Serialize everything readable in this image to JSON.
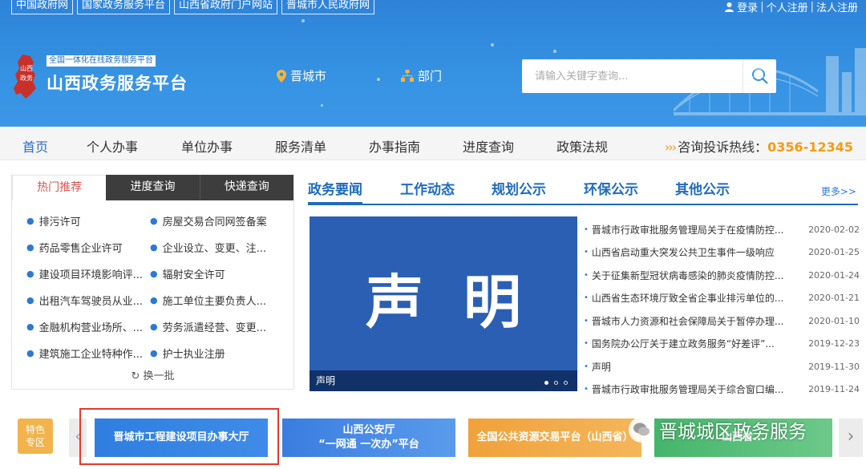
{
  "toplinks": [
    "中国政府网",
    "国家政务服务平台",
    "山西省政府门户网站",
    "晋城市人民政府网"
  ],
  "account": {
    "login": "登录",
    "personal_register": "个人注册",
    "corp_register": "法人注册"
  },
  "logo": {
    "emblem_text": "山西政务",
    "tag": "全国一体化在线政务服务平台",
    "title": "山西政务服务平台"
  },
  "location": "晋城市",
  "department": "部门",
  "search": {
    "placeholder": "请输入关键字查询..."
  },
  "nav": {
    "items": [
      "首页",
      "个人办事",
      "单位办事",
      "服务清单",
      "办事指南",
      "进度查询",
      "政策法规"
    ],
    "active_index": 0,
    "hotline_label": "咨询投诉热线：",
    "hotline_number": "0356-12345"
  },
  "left_panel": {
    "tabs": [
      "热门推荐",
      "进度查询",
      "快递查询"
    ],
    "items": [
      "排污许可",
      "房屋交易合同网签备案",
      "药品零售企业许可",
      "企业设立、变更、注...",
      "建设项目环境影响评...",
      "辐射安全许可",
      "出租汽车驾驶员从业...",
      "施工单位主要负责人...",
      "金融机构营业场所、...",
      "劳务派遣经营、变更...",
      "建筑施工企业特种作...",
      "护士执业注册"
    ],
    "refresh": "换一批"
  },
  "news": {
    "tabs": [
      "政务要闻",
      "工作动态",
      "规划公示",
      "环保公示",
      "其他公示"
    ],
    "more": "更多>>",
    "slide": {
      "big_text": "声明",
      "caption": "声明",
      "dots": 3,
      "active_dot": 0
    },
    "items": [
      {
        "title": "晋城市行政审批服务管理局关于在疫情防控...",
        "date": "2020-02-02"
      },
      {
        "title": "山西省启动重大突发公共卫生事件一级响应",
        "date": "2020-01-25"
      },
      {
        "title": "关于征集新型冠状病毒感染的肺炎疫情防控...",
        "date": "2020-01-24"
      },
      {
        "title": "山西省生态环境厅致全省企事业排污单位的...",
        "date": "2020-01-21"
      },
      {
        "title": "晋城市人力资源和社会保障局关于暂停办理...",
        "date": "2020-01-10"
      },
      {
        "title": "国务院办公厅关于建立政务服务“好差评”...",
        "date": "2019-12-23"
      },
      {
        "title": "声明",
        "date": "2019-11-30"
      },
      {
        "title": "晋城市行政审批服务管理局关于综合窗口编...",
        "date": "2019-11-24"
      }
    ]
  },
  "feature": {
    "line1": "特色",
    "line2": "专区"
  },
  "banners": [
    {
      "line1": "晋城市工程建设项目办事大厅",
      "line2": ""
    },
    {
      "line1": "山西公安厅",
      "line2": "“一网通 一次办”平台"
    },
    {
      "line1": "全国公共资源交易平台（山西省）",
      "line2": ""
    },
    {
      "line1": "山西省...",
      "line2": ""
    }
  ],
  "watermark": "晋城城区政务服务",
  "colors": {
    "banner_blue": "#3591e2",
    "accent_orange": "#f39c12",
    "link_blue": "#1f6bbd",
    "highlight_red": "#e43a2c"
  }
}
